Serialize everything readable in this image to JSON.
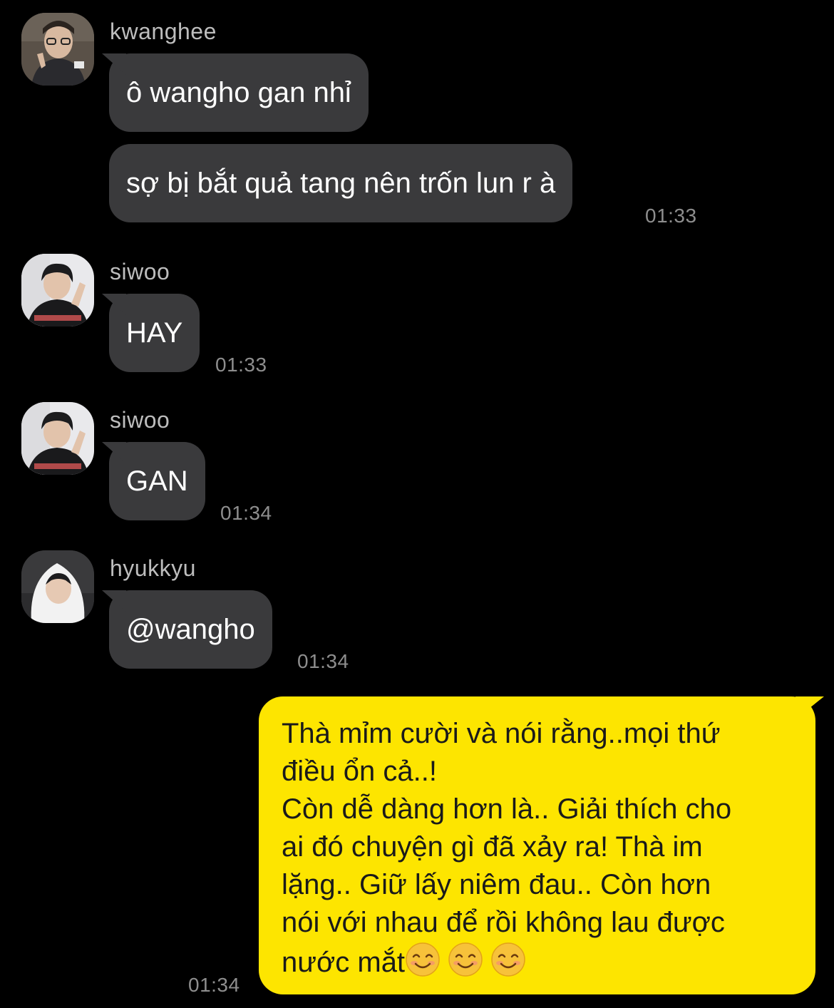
{
  "messages": {
    "m1": {
      "sender": "kwanghee",
      "lines": [
        "ô wangho gan nhỉ",
        "sợ bị bắt quả tang nên trốn lun r à"
      ],
      "time": "01:33"
    },
    "m2": {
      "sender": "siwoo",
      "text": "HAY",
      "time": "01:33"
    },
    "m3": {
      "sender": "siwoo",
      "text": "GAN",
      "time": "01:34"
    },
    "m4": {
      "sender": "hyukkyu",
      "text": "@wangho",
      "time": "01:34"
    },
    "mine": {
      "lines": [
        "Thà mỉm cười và nói rằng..mọi thứ",
        "điều ổn cả..!",
        "Còn dễ dàng hơn là.. Giải thích cho",
        "ai đó chuyện gì đã xảy ra! Thà im",
        "lặng.. Giữ lấy niêm đau.. Còn hơn",
        "nói với nhau để rồi không lau được",
        "nước mắt"
      ],
      "emojis": [
        "smiling-face-emoji",
        "smiling-face-emoji",
        "smiling-face-emoji"
      ],
      "time": "01:34"
    }
  },
  "colors": {
    "background": "#000000",
    "incoming_bubble": "#3a3a3c",
    "outgoing_bubble": "#fde500",
    "timestamp": "#8e8e8e",
    "sender_name": "#bdbdbd"
  }
}
